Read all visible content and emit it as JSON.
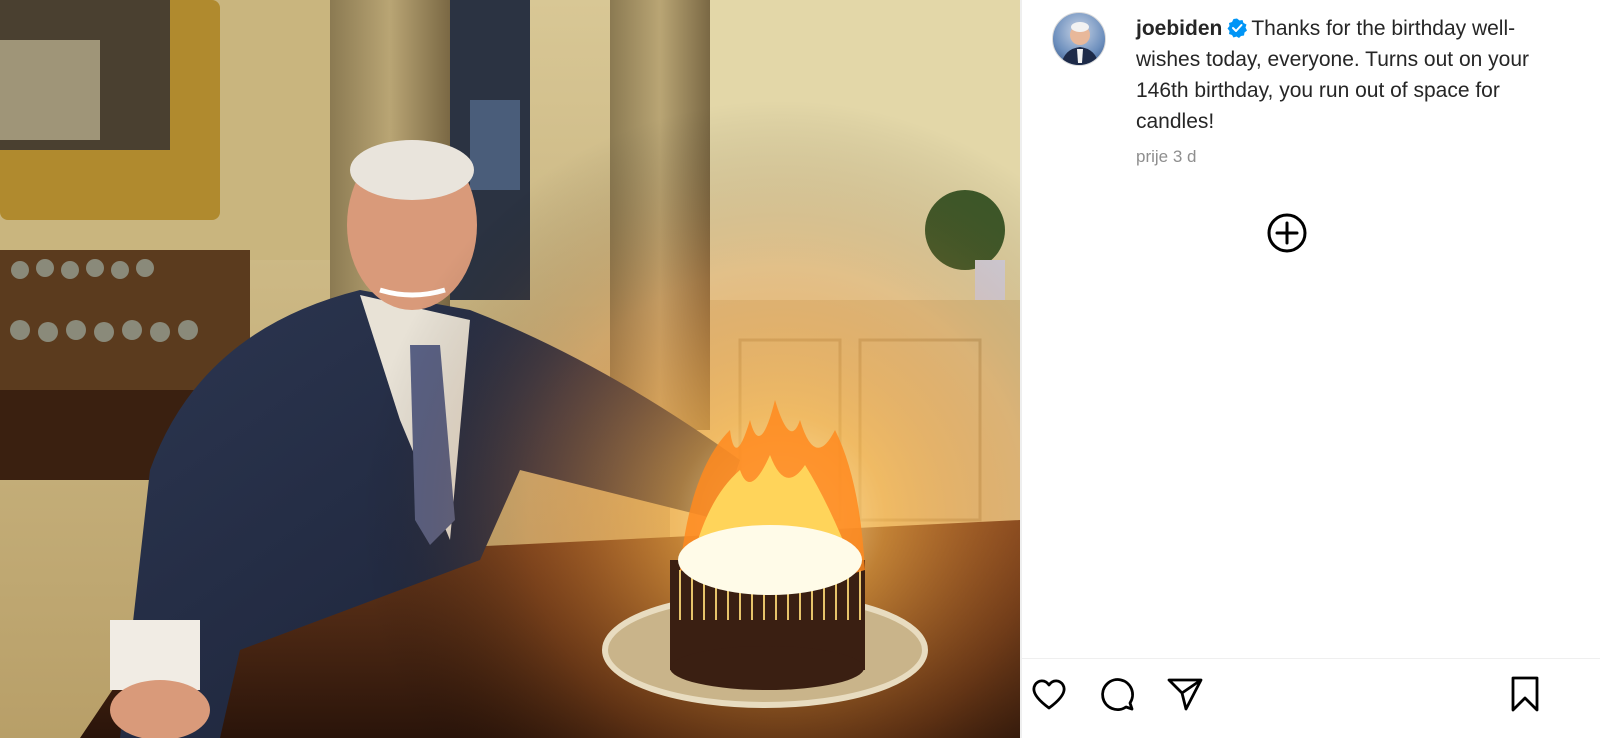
{
  "post": {
    "username": "joebiden",
    "verified": true,
    "caption": "Thanks for the birthday well-wishes today, everyone. Turns out on your 146th birthday, you run out of space for candles!",
    "timestamp": "prije 3 d"
  },
  "icons": {
    "verified": "verified-badge-icon",
    "more": "plus-circle-icon",
    "like": "heart-icon",
    "comment": "comment-icon",
    "share": "send-icon",
    "save": "bookmark-icon"
  },
  "colors": {
    "verified_blue": "#0095f6",
    "text": "#262626",
    "muted": "#8e8e8e"
  }
}
